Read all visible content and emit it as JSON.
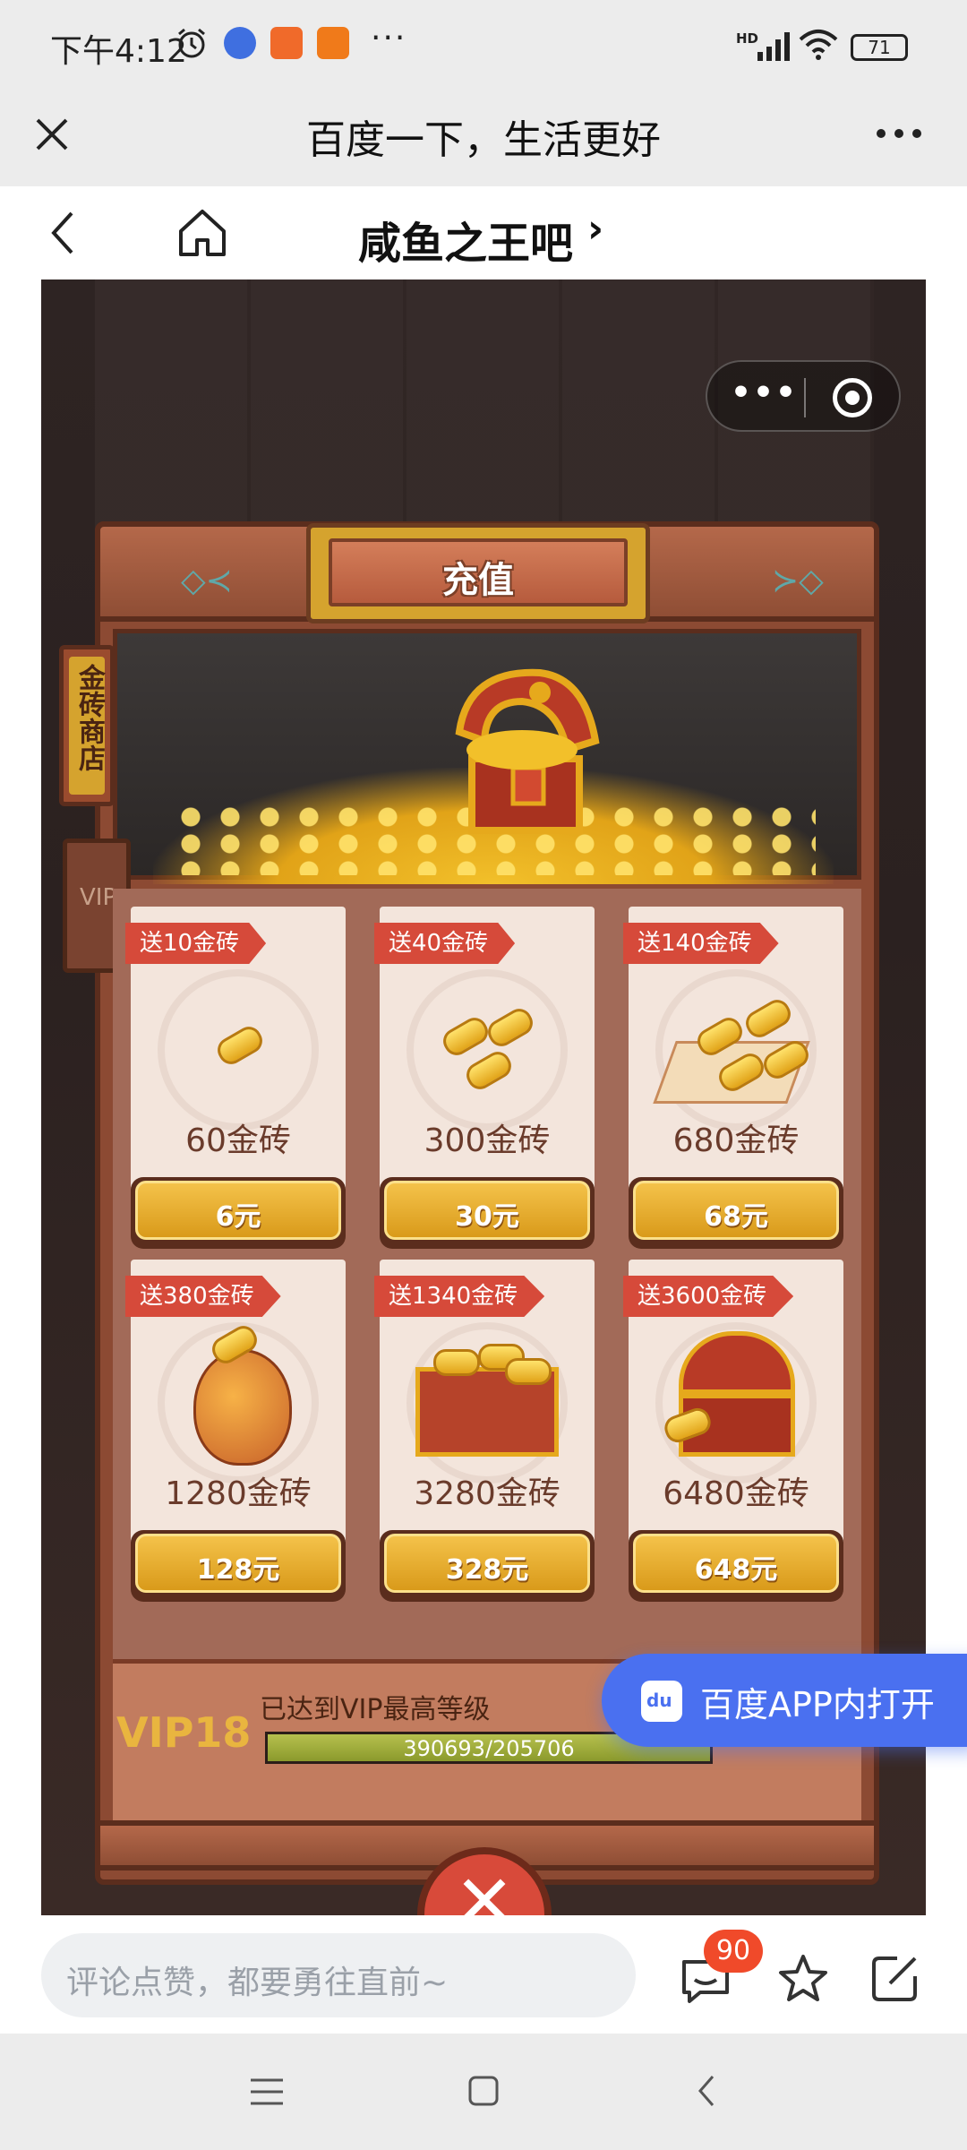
{
  "status_bar": {
    "time": "下午4:12",
    "more": "···",
    "network": "HD",
    "battery": "71"
  },
  "browser": {
    "title": "百度一下，生活更好"
  },
  "nav": {
    "forum_title": "咸鱼之王吧",
    "chevron": "›"
  },
  "shop": {
    "title": "充值",
    "side_tab_gold": "金砖商店",
    "side_tab_vip": "VIP",
    "products": [
      {
        "bonus": "送10金砖",
        "amount": "60金砖",
        "price": "6元"
      },
      {
        "bonus": "送40金砖",
        "amount": "300金砖",
        "price": "30元"
      },
      {
        "bonus": "送140金砖",
        "amount": "680金砖",
        "price": "68元"
      },
      {
        "bonus": "送380金砖",
        "amount": "1280金砖",
        "price": "128元"
      },
      {
        "bonus": "送1340金砖",
        "amount": "3280金砖",
        "price": "328元"
      },
      {
        "bonus": "送3600金砖",
        "amount": "6480金砖",
        "price": "648元"
      }
    ],
    "vip": {
      "level": "VIP18",
      "description": "已达到VIP最高等级",
      "progress_text": "390693/205706",
      "progress_fraction": 1.0
    }
  },
  "open_app": {
    "label": "百度APP内打开"
  },
  "comment_bar": {
    "placeholder": "评论点赞，都要勇往直前~",
    "comment_count": "90"
  },
  "colors": {
    "accent_blue": "#4a70f0",
    "badge_red": "#d64a3a",
    "gold": "#e1a318"
  }
}
